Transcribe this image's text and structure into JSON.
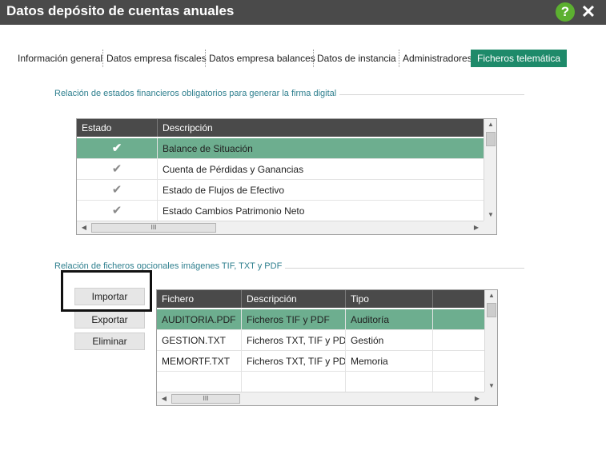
{
  "window": {
    "title": "Datos depósito de cuentas anuales",
    "help_icon": "help-icon",
    "help_glyph": "?",
    "close_icon": "close-icon",
    "close_glyph": "✕"
  },
  "tabs": [
    {
      "label": "Información general",
      "active": false
    },
    {
      "label": "Datos empresa fiscales",
      "active": false
    },
    {
      "label": "Datos empresa balances",
      "active": false
    },
    {
      "label": "Datos de instancia",
      "active": false
    },
    {
      "label": "Administradores",
      "active": false
    },
    {
      "label": "Ficheros telemática",
      "active": true
    }
  ],
  "section1": {
    "label": "Relación de estados financieros obligatorios para generar la firma digital",
    "columns": [
      "Estado",
      "Descripción"
    ],
    "rows": [
      {
        "estado": "✔",
        "descripcion": "Balance de Situación",
        "selected": true
      },
      {
        "estado": "✔",
        "descripcion": "Cuenta de Pérdidas y Ganancias",
        "selected": false
      },
      {
        "estado": "✔",
        "descripcion": "Estado de Flujos de Efectivo",
        "selected": false
      },
      {
        "estado": "✔",
        "descripcion": "Estado Cambios Patrimonio Neto",
        "selected": false
      }
    ]
  },
  "section2": {
    "label": "Relación de ficheros opcionales imágenes TIF, TXT y PDF",
    "buttons": {
      "import": "Importar",
      "export": "Exportar",
      "delete": "Eliminar"
    },
    "columns": [
      "Fichero",
      "Descripción",
      "Tipo",
      ""
    ],
    "rows": [
      {
        "fichero": "AUDITORIA.PDF",
        "descripcion": "Ficheros TIF y PDF",
        "tipo": "Auditoría",
        "selected": true
      },
      {
        "fichero": "GESTION.TXT",
        "descripcion": "Ficheros TXT, TIF y PDF",
        "tipo": "Gestión",
        "selected": false
      },
      {
        "fichero": "MEMORTF.TXT",
        "descripcion": "Ficheros TXT, TIF y PDF",
        "tipo": "Memoria",
        "selected": false
      },
      {
        "fichero": "",
        "descripcion": "",
        "tipo": "",
        "selected": false
      }
    ]
  },
  "scroll": {
    "up": "▲",
    "down": "▼",
    "left": "◀",
    "right": "▶",
    "grip": "III"
  },
  "colors": {
    "title_bg": "#4a4a4a",
    "accent": "#1e8a6a",
    "selected_row": "#6dae8f",
    "section_text": "#2e7f8e",
    "help_green": "#5cb030"
  }
}
